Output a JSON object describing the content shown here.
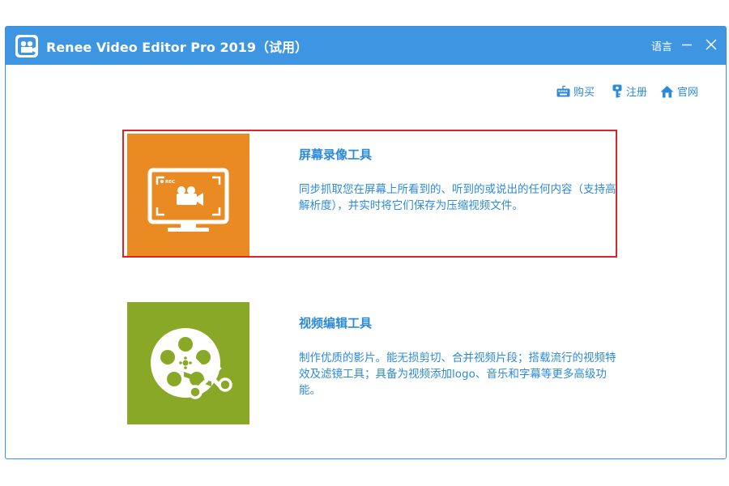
{
  "window": {
    "title": "Renee Video Editor Pro 2019（试用）",
    "language_label": "语言"
  },
  "toplinks": {
    "buy": "购买",
    "register": "注册",
    "website": "官网"
  },
  "tools": [
    {
      "title": "屏幕录像工具",
      "description": "同步抓取您在屏幕上所看到的、听到的或说出的任何内容（支持高解析度），并实时将它们保存为压缩视频文件。",
      "icon": "screen-record-icon",
      "icon_badge": "REC",
      "tile_color": "#e98b22",
      "selected": true
    },
    {
      "title": "视频编辑工具",
      "description": "制作优质的影片。能无损剪切、合并视频片段；搭载流行的视频特效及滤镜工具；具备为视频添加logo、音乐和字幕等更多高级功能。",
      "icon": "film-reel-scissors-icon",
      "tile_color": "#8aa827",
      "selected": false
    }
  ],
  "colors": {
    "titlebar": "#3e95e2",
    "accent_text": "#2c8ad8",
    "selection_border": "#e0232b"
  }
}
